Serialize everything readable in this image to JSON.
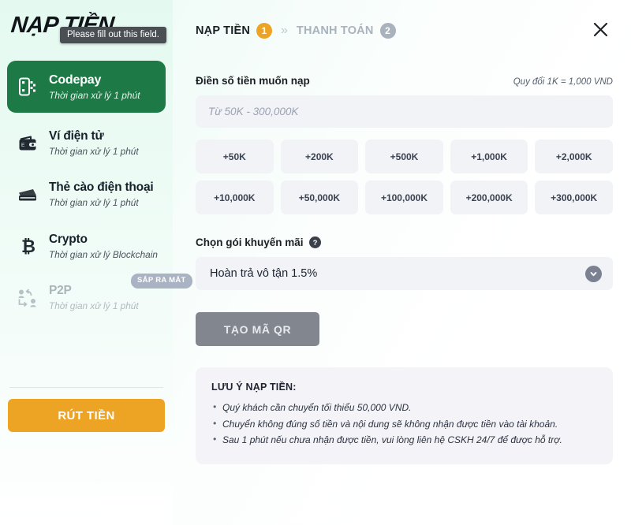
{
  "sidebar": {
    "brand": "NẠP TIỀN",
    "tooltip": "Please fill out this field.",
    "methods": [
      {
        "title": "Codepay",
        "sub": "Thời gian xử lý 1 phút",
        "icon": "codepay-qr-icon",
        "state": "active"
      },
      {
        "title": "Ví điện tử",
        "sub": "Thời gian xử lý 1 phút",
        "icon": "wallet-icon",
        "state": "normal"
      },
      {
        "title": "Thẻ cào điện thoại",
        "sub": "Thời gian xử lý 1 phút",
        "icon": "card-icon",
        "state": "normal"
      },
      {
        "title": "Crypto",
        "sub": "Thời gian xử lý Blockchain",
        "icon": "bitcoin-icon",
        "state": "normal"
      },
      {
        "title": "P2P",
        "sub": "Thời gian xử lý 1 phút",
        "icon": "p2p-transfer-icon",
        "state": "dim",
        "badge": "SẮP RA MẮT"
      }
    ],
    "withdraw_label": "RÚT TIỀN"
  },
  "header": {
    "steps": [
      {
        "label": "NẠP TIỀN",
        "num": "1",
        "state": "active"
      },
      {
        "label": "THANH TOÁN",
        "num": "2",
        "state": "inactive"
      }
    ],
    "separator": "»",
    "close_icon": "close-icon"
  },
  "amount": {
    "section_title": "Điền số tiền muốn nạp",
    "rate_note": "Quy đổi 1K = 1,000 VND",
    "input_value": "",
    "input_placeholder": "Từ 50K - 300,000K",
    "quick_amounts": [
      "+50K",
      "+200K",
      "+500K",
      "+1,000K",
      "+2,000K",
      "+10,000K",
      "+50,000K",
      "+100,000K",
      "+200,000K",
      "+300,000K"
    ]
  },
  "promo": {
    "title": "Chọn gói khuyến mãi",
    "help_icon": "help-circle-icon",
    "selected": "Hoàn trả vô tận 1.5%",
    "chevron_icon": "chevron-down-icon"
  },
  "actions": {
    "qr_label": "TẠO MÃ QR"
  },
  "notes": {
    "title": "LƯU Ý NẠP TIỀN:",
    "items": [
      "Quý khách cần chuyển tối thiểu 50,000 VND.",
      "Chuyển không đúng số tiền và nội dung sẽ không nhận được tiền vào tài khoản.",
      "Sau 1 phút nếu chưa nhận được tiền, vui lòng liên hệ CSKH 24/7 để được hỗ trợ."
    ]
  },
  "colors": {
    "active_green": "#1d7a46",
    "accent_orange": "#eda323",
    "muted_grey": "#82868f",
    "field_bg": "#f2f3f7"
  }
}
